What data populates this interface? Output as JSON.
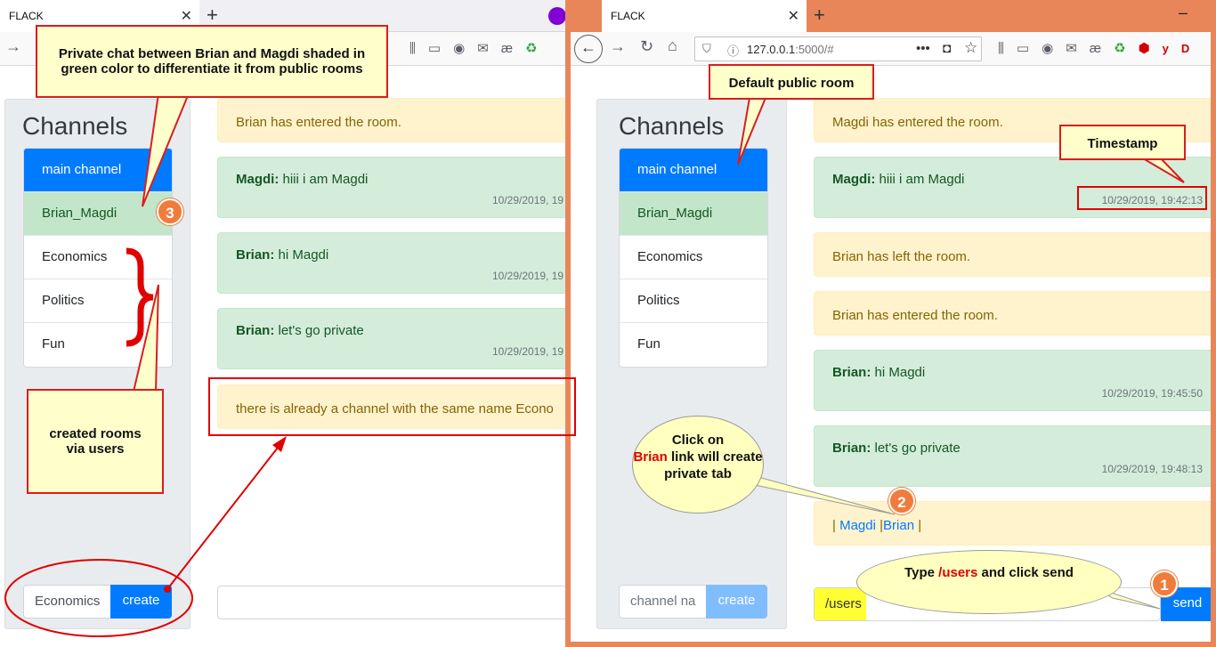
{
  "left_window": {
    "tab_title": "FLACK",
    "channels_title": "Channels",
    "channels": [
      "main channel",
      "Brian_Magdi",
      "Economics",
      "Politics",
      "Fun"
    ],
    "messages": [
      {
        "type": "status",
        "text": "Brian has entered the room."
      },
      {
        "type": "chat",
        "user": "Magdi:",
        "text": " hiii i am Magdi",
        "ts": "10/29/2019, 19"
      },
      {
        "type": "chat",
        "user": "Brian:",
        "text": " hi Magdi",
        "ts": "10/29/2019, 19"
      },
      {
        "type": "chat",
        "user": "Brian:",
        "text": " let's go private",
        "ts": "10/29/2019, 19"
      },
      {
        "type": "status",
        "text": "there is already a channel with the same name Econo"
      }
    ],
    "channel_input_value": "Economics",
    "create_label": "create"
  },
  "right_window": {
    "tab_title": "FLACK",
    "url_host": "127.0.0.1",
    "url_rest": ":5000/#",
    "channels_title": "Channels",
    "channels": [
      "main channel",
      "Brian_Magdi",
      "Economics",
      "Politics",
      "Fun"
    ],
    "messages": [
      {
        "type": "status",
        "text": "Magdi has entered the room."
      },
      {
        "type": "chat",
        "user": "Magdi:",
        "text": " hiii i am Magdi",
        "ts": "10/29/2019, 19:42:13"
      },
      {
        "type": "status",
        "text": "Brian has left the room."
      },
      {
        "type": "status",
        "text": "Brian has entered the room."
      },
      {
        "type": "chat",
        "user": "Brian:",
        "text": " hi Magdi",
        "ts": "10/29/2019, 19:45:50"
      },
      {
        "type": "chat",
        "user": "Brian:",
        "text": " let's go private",
        "ts": "10/29/2019, 19:48:13"
      }
    ],
    "users_line": {
      "pre": "| ",
      "u1": "Magdi",
      "mid": " |",
      "u2": "Brian",
      "post": " |"
    },
    "channel_input_placeholder": "channel na",
    "create_label": "create",
    "message_input_value": "/users",
    "send_label": "send"
  },
  "annotations": {
    "private_chat": "Private chat between Brian and Magdi shaded in green color to differentiate it from public rooms",
    "created_rooms": "created rooms via users",
    "default_room": "Default public room",
    "timestamp": "Timestamp",
    "click_pre": "Click on",
    "click_name": "Brian",
    "click_post": "link will create private tab",
    "type_pre": "Type",
    "type_cmd": "/users",
    "type_post": "and click send",
    "n1": "1",
    "n2": "2",
    "n3": "3"
  },
  "colors": {
    "accent": "#007bff",
    "private": "#c3e6cb",
    "status": "#fff3cd",
    "chat": "#d4edda",
    "annotation_border": "#e00000",
    "window_border": "#e8865a"
  }
}
